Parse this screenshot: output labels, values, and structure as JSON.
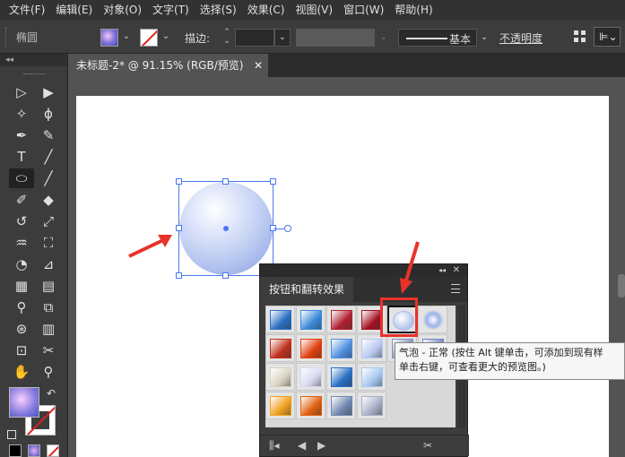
{
  "menu": [
    "文件(F)",
    "编辑(E)",
    "对象(O)",
    "文字(T)",
    "选择(S)",
    "效果(C)",
    "视图(V)",
    "窗口(W)",
    "帮助(H)"
  ],
  "control_bar": {
    "object_name": "椭圆",
    "stroke_label": "描边",
    "stroke_colon": ":",
    "brush_label": "基本",
    "opacity_label": "不透明度"
  },
  "left_panel_collapse": "◂◂",
  "document": {
    "tab_title": "未标题-2* @ 91.15% (RGB/预览)",
    "close": "✕"
  },
  "panel": {
    "title": "按钮和翻转效果",
    "collapse": "◂◂",
    "close": "✕",
    "swatches": [
      {
        "name": "blue-square-inset",
        "color": "#2a6fc4"
      },
      {
        "name": "blue-square-bevel",
        "color": "#3a8ad8"
      },
      {
        "name": "red-rounded",
        "color": "#b02030"
      },
      {
        "name": "red-square-gloss",
        "color": "#a01020"
      },
      {
        "name": "bubble-normal",
        "color": "#a8bce8"
      },
      {
        "name": "starburst-blue",
        "color": "#9ab4e8"
      },
      {
        "name": "red-orange-square",
        "color": "#c0301c"
      },
      {
        "name": "fire-orange",
        "color": "#e04010"
      },
      {
        "name": "blue-gloss-square",
        "color": "#4f8fe0"
      },
      {
        "name": "light-blue-square",
        "color": "#b8c8f0"
      },
      {
        "name": "steel-frame",
        "color": "#8090b8"
      },
      {
        "name": "purple-frame",
        "color": "#7080c0"
      },
      {
        "name": "beige-square",
        "color": "#d8d4c0"
      },
      {
        "name": "lavender-square",
        "color": "#d8d8f0"
      },
      {
        "name": "blue-gradient",
        "color": "#2a6fc4"
      },
      {
        "name": "light-blue-gradient",
        "color": "#a8c8f0"
      },
      {
        "name": "orange-yellow",
        "color": "#f0a020"
      },
      {
        "name": "orange-red",
        "color": "#e06010"
      },
      {
        "name": "gray-blue-frame",
        "color": "#7088b0"
      },
      {
        "name": "silver-frame",
        "color": "#a8b0c8"
      }
    ]
  },
  "tooltip": {
    "line1": "气泡 - 正常 (按住 Alt 键单击，可添加到现有样",
    "line2": "单击右键，可查看更大的预览图。)"
  }
}
